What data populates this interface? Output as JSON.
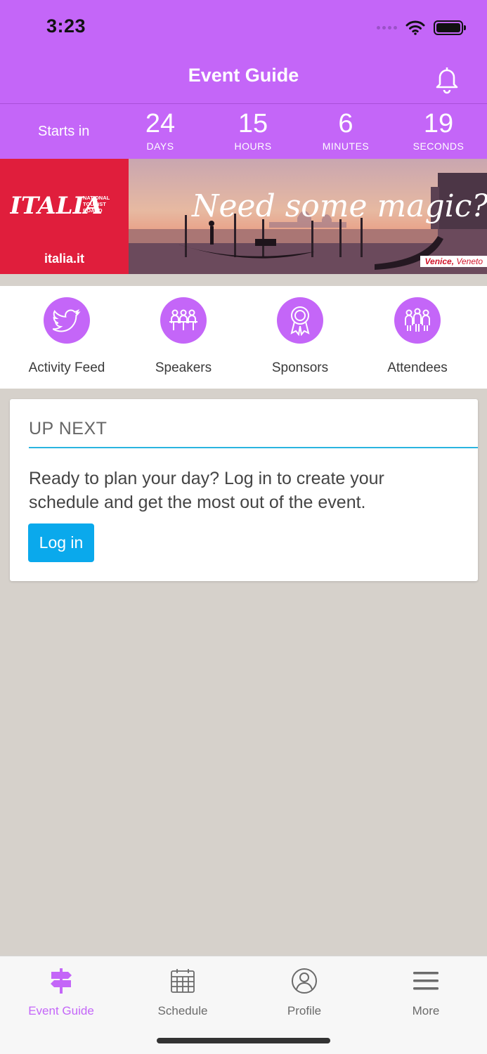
{
  "status": {
    "time": "3:23"
  },
  "header": {
    "title": "Event Guide",
    "bell_icon": "bell-icon"
  },
  "countdown": {
    "label": "Starts in",
    "units": [
      {
        "value": "24",
        "label": "DAYS"
      },
      {
        "value": "15",
        "label": "HOURS"
      },
      {
        "value": "6",
        "label": "MINUTES"
      },
      {
        "value": "19",
        "label": "SECONDS"
      }
    ]
  },
  "banner": {
    "brand_line1": "ITALIA",
    "brand_line2": "NATIONAL TOURIST BOARD",
    "brand_url": "italia.it",
    "tagline": "Need some magic?",
    "location_city": "Venice,",
    "location_region": "Veneto"
  },
  "quicknav": {
    "items": [
      {
        "label": "Activity Feed",
        "icon": "twitter-bird-icon"
      },
      {
        "label": "Speakers",
        "icon": "speakers-icon"
      },
      {
        "label": "Sponsors",
        "icon": "ribbon-award-icon"
      },
      {
        "label": "Attendees",
        "icon": "attendees-icon"
      }
    ]
  },
  "up_next": {
    "title": "UP NEXT",
    "text": "Ready to plan your day? Log in to create your schedule and get the most out of the event.",
    "button": "Log in"
  },
  "tabbar": {
    "tabs": [
      {
        "label": "Event Guide",
        "icon": "signpost-icon",
        "active": true
      },
      {
        "label": "Schedule",
        "icon": "calendar-icon",
        "active": false
      },
      {
        "label": "Profile",
        "icon": "user-circle-icon",
        "active": false
      },
      {
        "label": "More",
        "icon": "hamburger-menu-icon",
        "active": false
      }
    ]
  },
  "colors": {
    "accent": "#c466f8",
    "link": "#0aa9ec",
    "rule": "#2ab4e0",
    "brand_red": "#e01e3c"
  }
}
